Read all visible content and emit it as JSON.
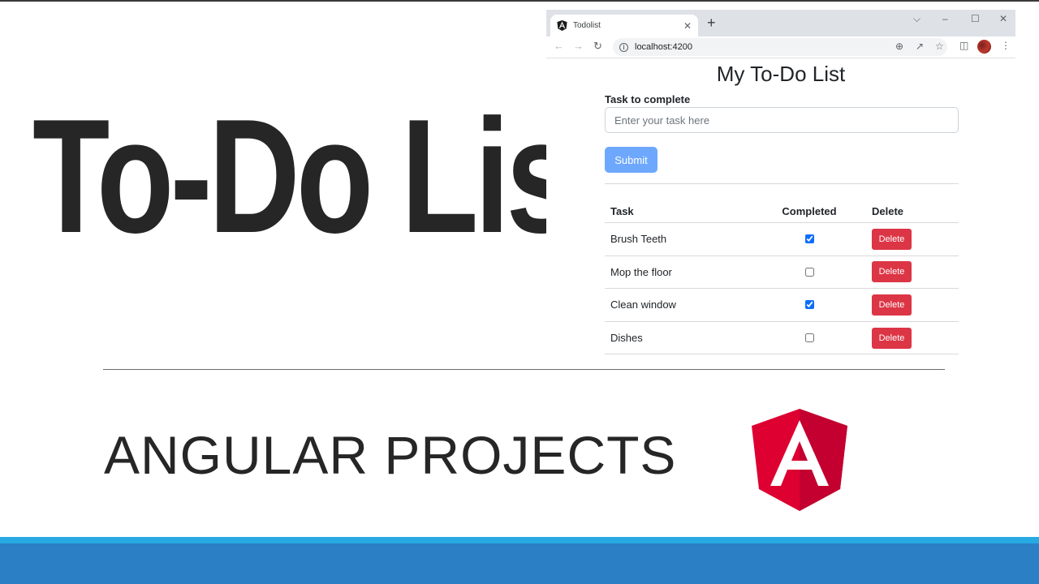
{
  "slide": {
    "big_title": "To-Do  List",
    "subtitle": "ANGULAR PROJECTS",
    "logo_letter": "A"
  },
  "browser": {
    "tab_title": "Todolist",
    "tab_close": "✕",
    "new_tab": "+",
    "url": "localhost:4200",
    "window_controls": {
      "chevron": "⌵",
      "minimize": "–",
      "maximize": "☐",
      "close": "✕"
    },
    "icons": [
      "back-arrow-icon",
      "forward-arrow-icon",
      "reload-icon",
      "info-icon",
      "zoom-icon",
      "share-icon",
      "star-icon",
      "side-panel-icon",
      "avatar",
      "menu-icon"
    ]
  },
  "app": {
    "title": "My To-Do List",
    "form": {
      "label": "Task to complete",
      "placeholder": "Enter your task here",
      "submit_label": "Submit"
    },
    "table": {
      "headers": {
        "task": "Task",
        "completed": "Completed",
        "delete": "Delete"
      },
      "rows": [
        {
          "task": "Brush Teeth",
          "completed": true,
          "delete_label": "Delete"
        },
        {
          "task": "Mop the floor",
          "completed": false,
          "delete_label": "Delete"
        },
        {
          "task": "Clean window",
          "completed": true,
          "delete_label": "Delete"
        },
        {
          "task": "Dishes",
          "completed": false,
          "delete_label": "Delete"
        }
      ]
    }
  },
  "colors": {
    "submit": "#6ea8fe",
    "delete": "#dc3545",
    "footer_strip": "#27a9e1",
    "footer_band": "#2b7fc4",
    "logo_red": "#dd0031",
    "logo_dark_red": "#c3002f"
  }
}
